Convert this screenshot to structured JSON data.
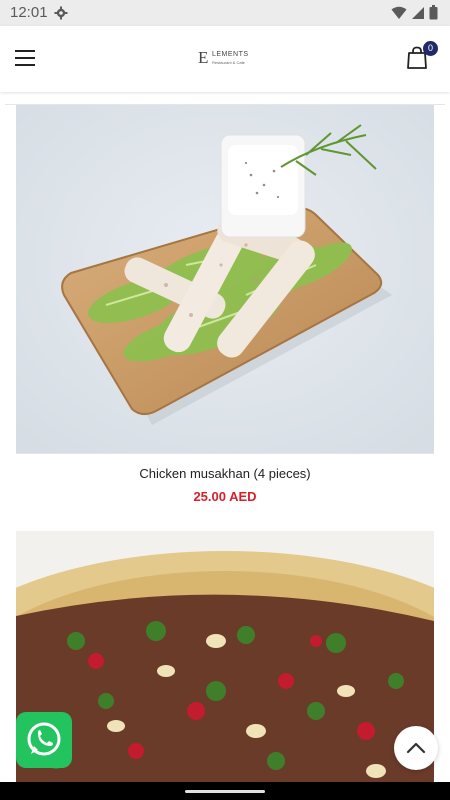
{
  "status_bar": {
    "time": "12:01",
    "icons": [
      "gear-icon",
      "wifi-icon",
      "signal-icon",
      "battery-icon"
    ]
  },
  "header": {
    "menu_icon": "hamburger-menu-icon",
    "logo": {
      "mark": "E",
      "text": "LEMENTS",
      "subtext": "Restaurant & Cafe"
    },
    "cart_icon": "shopping-bag-icon",
    "cart_count": "0"
  },
  "products": [
    {
      "name": "Chicken musakhan (4 pieces)",
      "price": "25.00 AED",
      "image": "chicken-musakhan-rolls-photo"
    },
    {
      "name": "",
      "price": "",
      "image": "hummus-with-meat-pomegranate-photo"
    }
  ],
  "floating": {
    "whatsapp_icon": "whatsapp-icon",
    "scroll_top_icon": "chevron-up-icon"
  },
  "colors": {
    "price": "#d6202a",
    "badge": "#1f2a6b",
    "whatsapp": "#23c35f"
  }
}
